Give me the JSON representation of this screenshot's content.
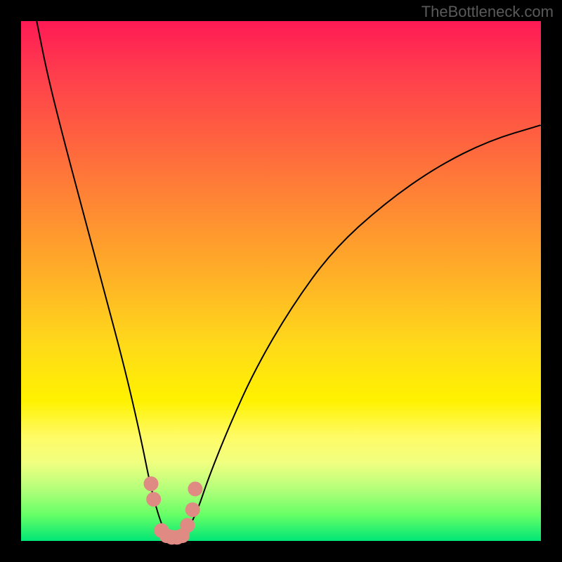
{
  "watermark": "TheBottleneck.com",
  "colors": {
    "background": "#000000",
    "gradient_top": "#ff1a55",
    "gradient_mid": "#ffe600",
    "gradient_bottom": "#00e676",
    "curve": "#000000",
    "marker": "#e08a84"
  },
  "chart_data": {
    "type": "line",
    "title": "",
    "xlabel": "",
    "ylabel": "",
    "xlim": [
      0,
      100
    ],
    "ylim": [
      0,
      100
    ],
    "series": [
      {
        "name": "bottleneck-curve",
        "x": [
          3,
          5,
          8,
          12,
          16,
          20,
          23,
          25,
          27,
          28.5,
          30,
          32,
          34,
          36,
          40,
          45,
          52,
          60,
          70,
          80,
          90,
          100
        ],
        "y": [
          100,
          90,
          78,
          63,
          48,
          33,
          20,
          10,
          3,
          0.5,
          0.5,
          2,
          6,
          12,
          22,
          33,
          45,
          56,
          65,
          72,
          77,
          80
        ]
      },
      {
        "name": "highlight-markers",
        "x": [
          25,
          25.5,
          27,
          28,
          29,
          30,
          31,
          32,
          33,
          33.5
        ],
        "y": [
          11,
          8,
          2,
          1,
          0.7,
          0.7,
          1,
          3,
          6,
          10
        ]
      }
    ]
  }
}
